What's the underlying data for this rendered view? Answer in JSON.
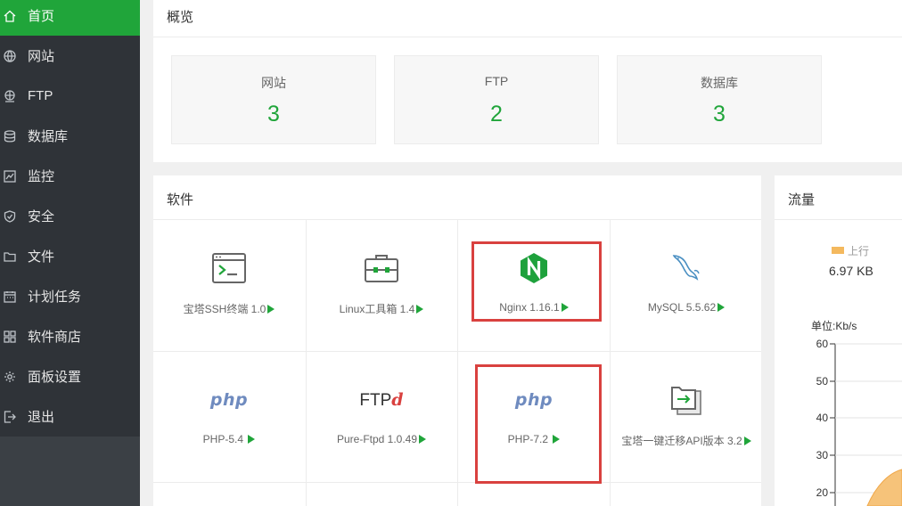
{
  "sidebar": {
    "items": [
      {
        "label": "首页",
        "icon": "home-icon",
        "active": true
      },
      {
        "label": "网站",
        "icon": "globe-icon"
      },
      {
        "label": "FTP",
        "icon": "ftp-icon"
      },
      {
        "label": "数据库",
        "icon": "database-icon"
      },
      {
        "label": "监控",
        "icon": "monitor-icon"
      },
      {
        "label": "安全",
        "icon": "shield-icon"
      },
      {
        "label": "文件",
        "icon": "folder-icon"
      },
      {
        "label": "计划任务",
        "icon": "calendar-icon"
      },
      {
        "label": "软件商店",
        "icon": "grid-icon"
      },
      {
        "label": "面板设置",
        "icon": "gear-icon"
      },
      {
        "label": "退出",
        "icon": "logout-icon"
      }
    ]
  },
  "overview": {
    "title": "概览",
    "cards": [
      {
        "label": "网站",
        "value": "3"
      },
      {
        "label": "FTP",
        "value": "2"
      },
      {
        "label": "数据库",
        "value": "3"
      }
    ]
  },
  "software": {
    "title": "软件",
    "items": [
      {
        "label": "宝塔SSH终端 1.0",
        "icon": "terminal-icon"
      },
      {
        "label": "Linux工具箱 1.4",
        "icon": "toolbox-icon"
      },
      {
        "label": "Nginx 1.16.1",
        "icon": "nginx-icon"
      },
      {
        "label": "MySQL 5.5.62",
        "icon": "mysql-dolphin-icon"
      },
      {
        "label": "PHP-5.4 ",
        "icon": "php-icon",
        "icon_text": "php"
      },
      {
        "label": "Pure-Ftpd 1.0.49",
        "icon": "ftpd-icon",
        "icon_text": "FTP",
        "icon_text_accent": "d"
      },
      {
        "label": "PHP-7.2 ",
        "icon": "php-icon",
        "icon_text": "php"
      },
      {
        "label": "宝塔一键迁移API版本 3.2",
        "icon": "migrate-icon"
      }
    ]
  },
  "traffic": {
    "title": "流量",
    "legend_label": "上行",
    "upload_value": "6.97 KB",
    "unit_label": "单位:Kb/s",
    "y_ticks": [
      "60",
      "50",
      "40",
      "30",
      "20"
    ]
  },
  "chart_data": {
    "type": "area",
    "ylabel": "单位:Kb/s",
    "ylim": [
      20,
      60
    ],
    "yticks": [
      60,
      50,
      40,
      30,
      20
    ],
    "series": [
      {
        "name": "上行"
      }
    ]
  },
  "colors": {
    "accent_green": "#20a53a",
    "highlight_red": "#d9413f",
    "upload_orange": "#f4b95e",
    "sidebar_bg": "#2f3338"
  }
}
